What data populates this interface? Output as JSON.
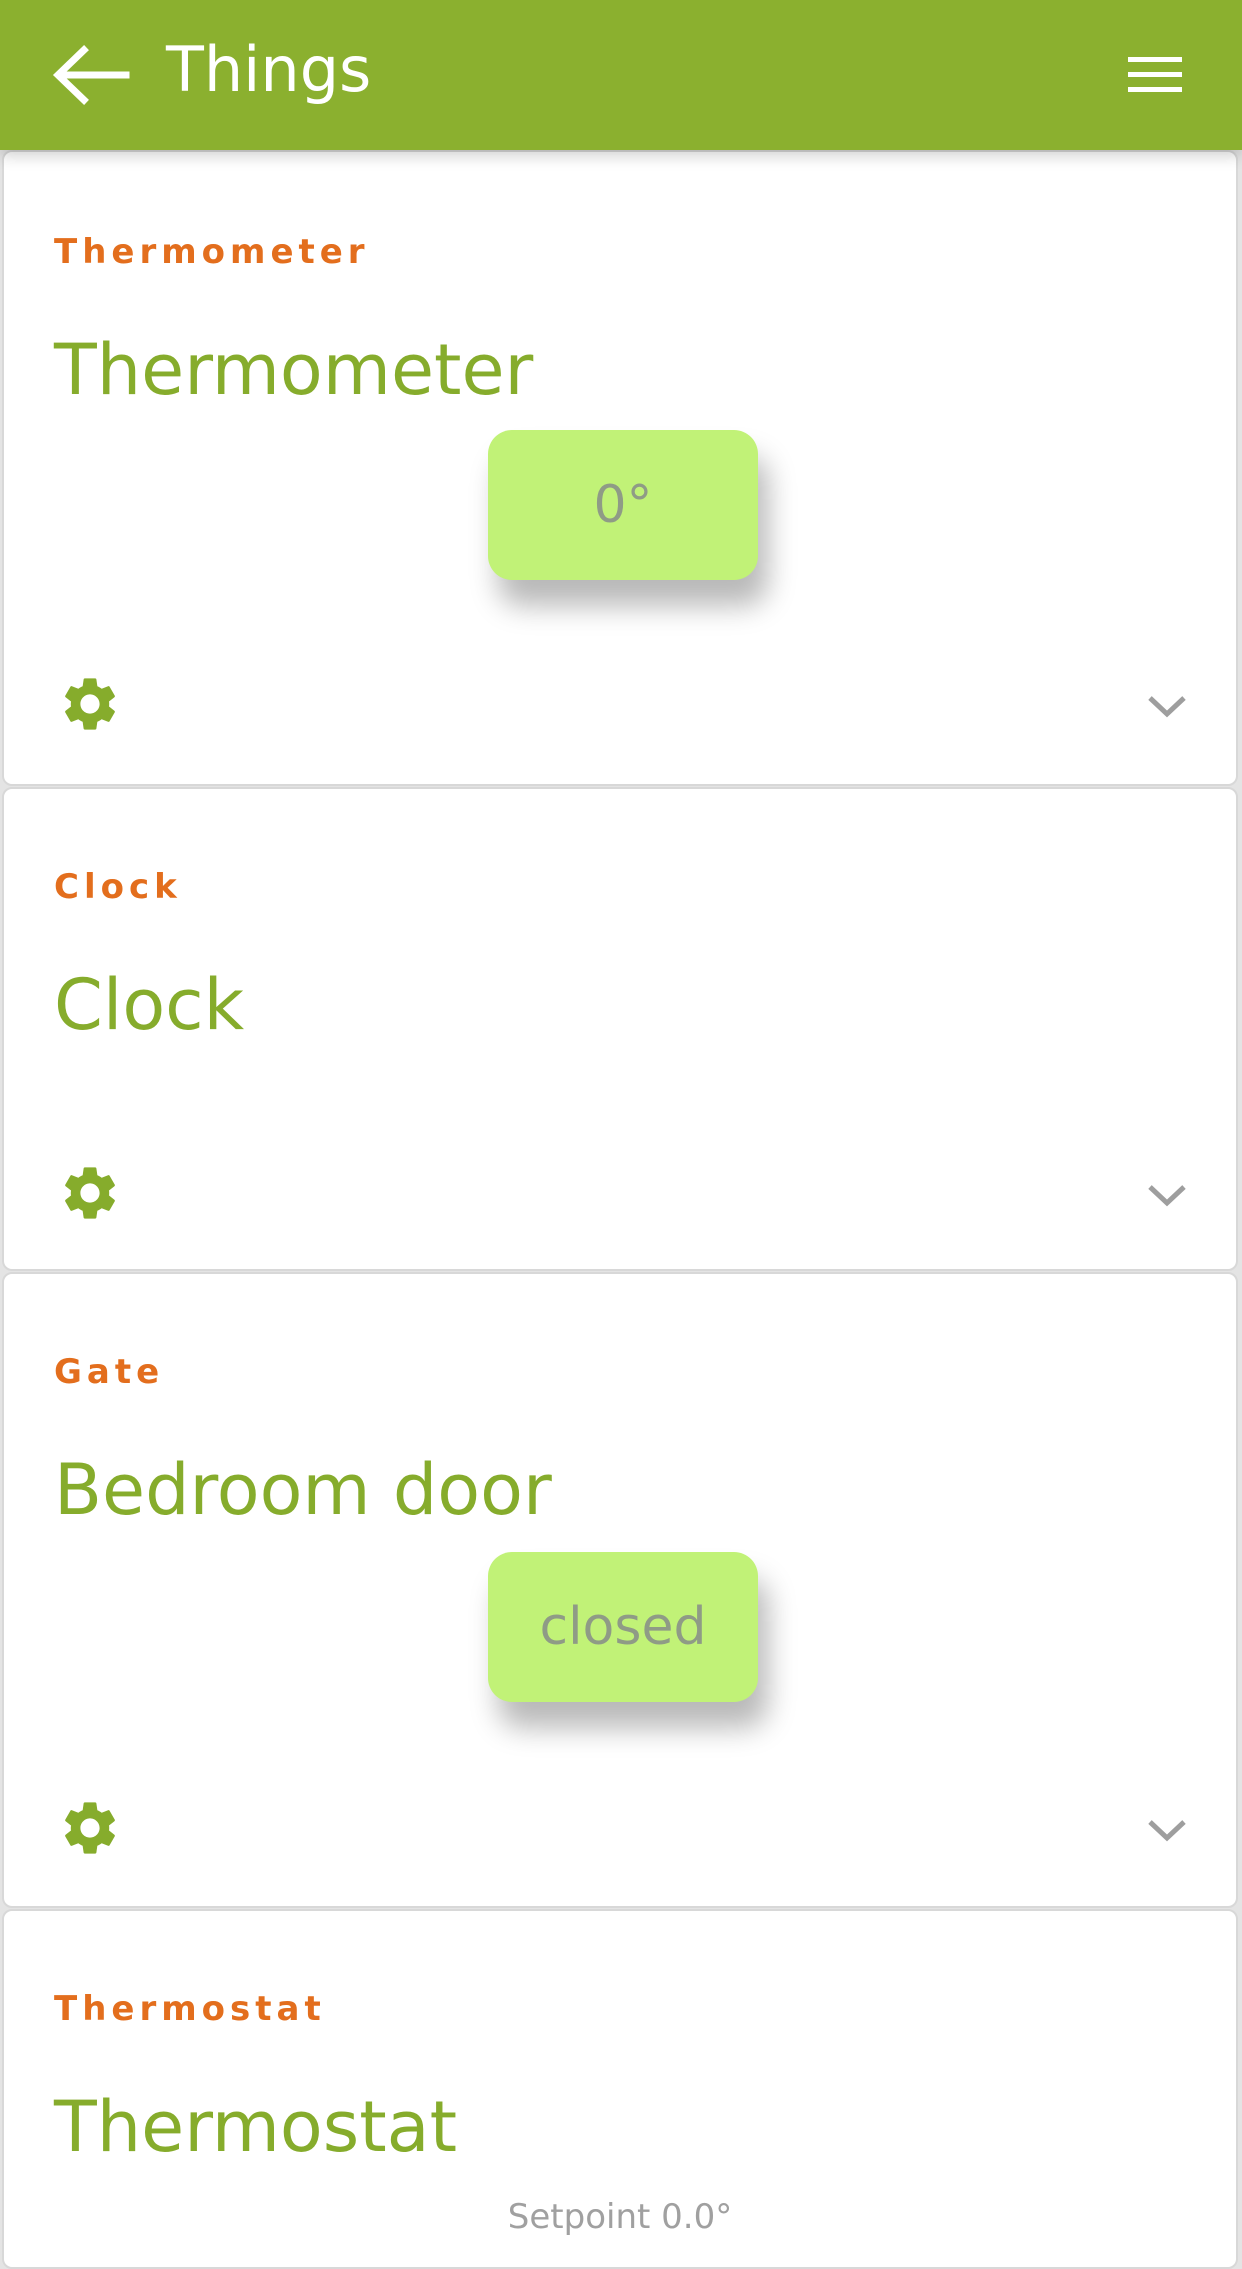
{
  "appbar": {
    "title": "Things",
    "back_icon": "arrow-left-icon",
    "menu_icon": "hamburger-menu-icon",
    "color": "#8bb02f"
  },
  "colors": {
    "type_label": "#e36e1d",
    "name": "#86ac2c",
    "pill_bg": "#c1f277",
    "pill_text": "#8f9b86",
    "icon_green": "#86ac2c",
    "chevron": "#9e9e9e"
  },
  "cards": [
    {
      "type": "Thermometer",
      "name": "Thermometer",
      "value": "0°"
    },
    {
      "type": "Clock",
      "name": "Clock"
    },
    {
      "type": "Gate",
      "name": "Bedroom door",
      "value": "closed"
    },
    {
      "type": "Thermostat",
      "name": "Thermostat",
      "setpoint": "Setpoint 0.0°"
    }
  ],
  "icons": {
    "settings": "gear-icon",
    "expand": "chevron-down-icon"
  }
}
